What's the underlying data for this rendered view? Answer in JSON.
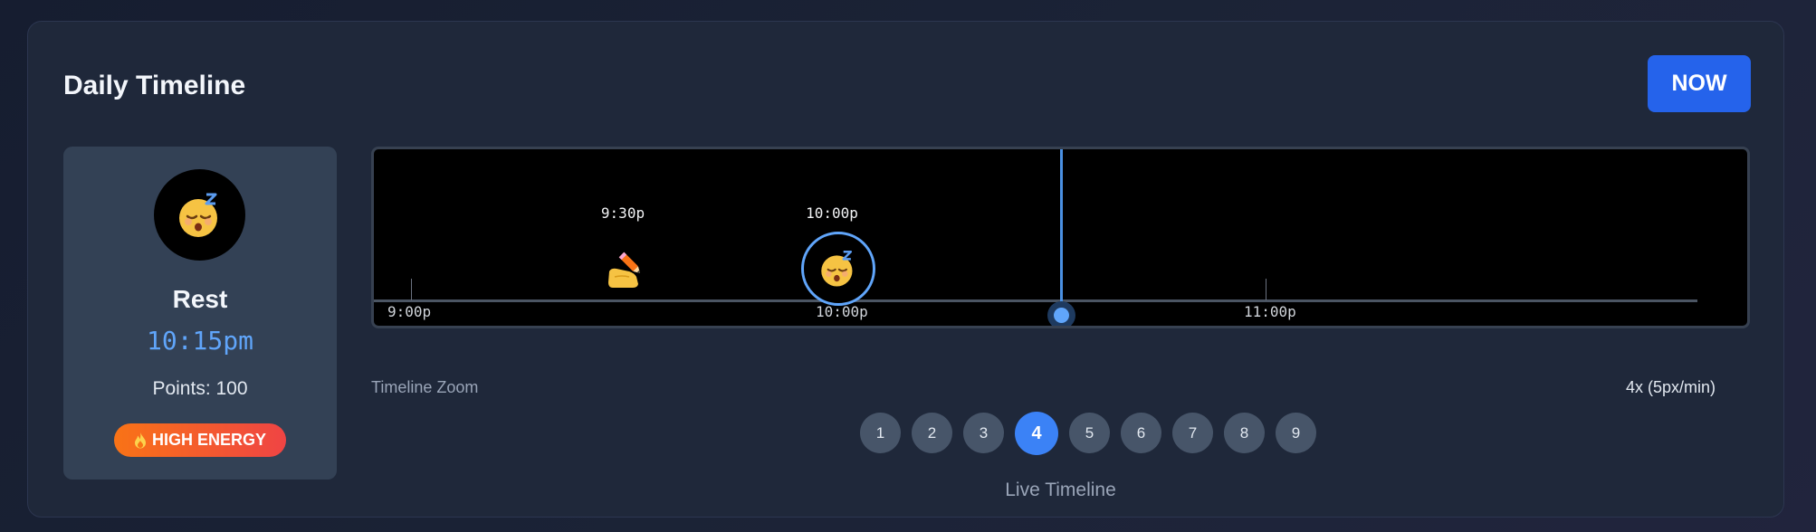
{
  "header": {
    "title": "Daily Timeline",
    "now_label": "NOW"
  },
  "status": {
    "icon": "sleeping-face-icon",
    "activity": "Rest",
    "time": "10:15pm",
    "points": "Points: 100",
    "energy_icon": "fire-icon",
    "energy": "HIGH ENERGY"
  },
  "timeline": {
    "ticks": [
      "9:00p",
      "10:00p",
      "11:00p"
    ],
    "events": [
      {
        "time": "9:30p",
        "icon": "writing-hand-icon",
        "active": false
      },
      {
        "time": "10:00p",
        "icon": "sleeping-face-icon",
        "active": true
      }
    ]
  },
  "zoom": {
    "label": "Timeline Zoom",
    "value": "4x (5px/min)",
    "levels": [
      "1",
      "2",
      "3",
      "4",
      "5",
      "6",
      "7",
      "8",
      "9"
    ],
    "selected": "4"
  },
  "footer": {
    "label": "Live Timeline"
  },
  "colors": {
    "accent": "#3b82f6",
    "now_line": "#4a90e2",
    "energy_from": "#f97316",
    "energy_to": "#ef4444"
  }
}
